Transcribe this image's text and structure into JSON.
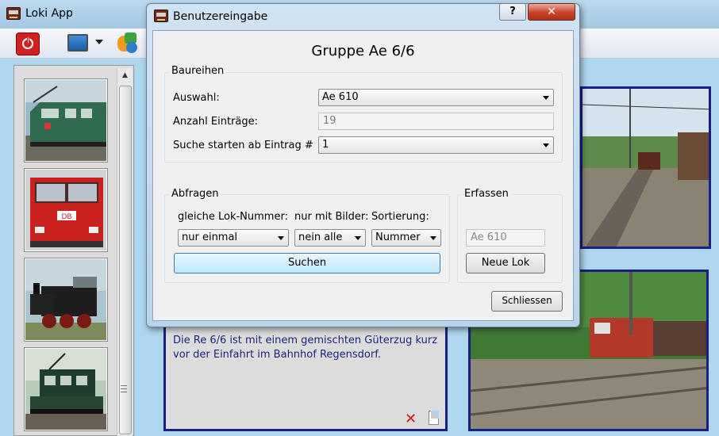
{
  "main_window": {
    "title": "Loki App"
  },
  "description": {
    "text": "Die Re 6/6 ist mit einem gemischten Güterzug kurz vor der Einfahrt im Bahnhof Regensdorf."
  },
  "dialog": {
    "title": "Benutzereingabe",
    "help_label": "?",
    "close_label": "✕",
    "heading": "Gruppe Ae 6/6",
    "baureihen": {
      "group_label": "Baureihen",
      "auswahl_label": "Auswahl:",
      "auswahl_value": "Ae 610",
      "anzahl_label": "Anzahl Einträge:",
      "anzahl_value": "19",
      "suche_label": "Suche starten ab Eintrag #",
      "suche_value": "1"
    },
    "abfragen": {
      "group_label": "Abfragen",
      "lok_label": "gleiche Lok-Nummer:",
      "lok_value": "nur einmal",
      "bilder_label": "nur mit Bilder:",
      "bilder_value": "nein alle",
      "sort_label": "Sortierung:",
      "sort_value": "Nummer",
      "search_button": "Suchen"
    },
    "erfassen": {
      "group_label": "Erfassen",
      "field_value": "Ae 610",
      "new_button": "Neue Lok"
    },
    "close_button": "Schliessen"
  },
  "icons": [
    "app-icon",
    "power-icon",
    "screen-icon",
    "color-palette-icon",
    "delete-icon",
    "document-icon",
    "scroll-up-icon"
  ],
  "colors": {
    "accent_border": "#1b1f84",
    "close_red": "#c8432b",
    "power_red": "#d21f1f"
  }
}
